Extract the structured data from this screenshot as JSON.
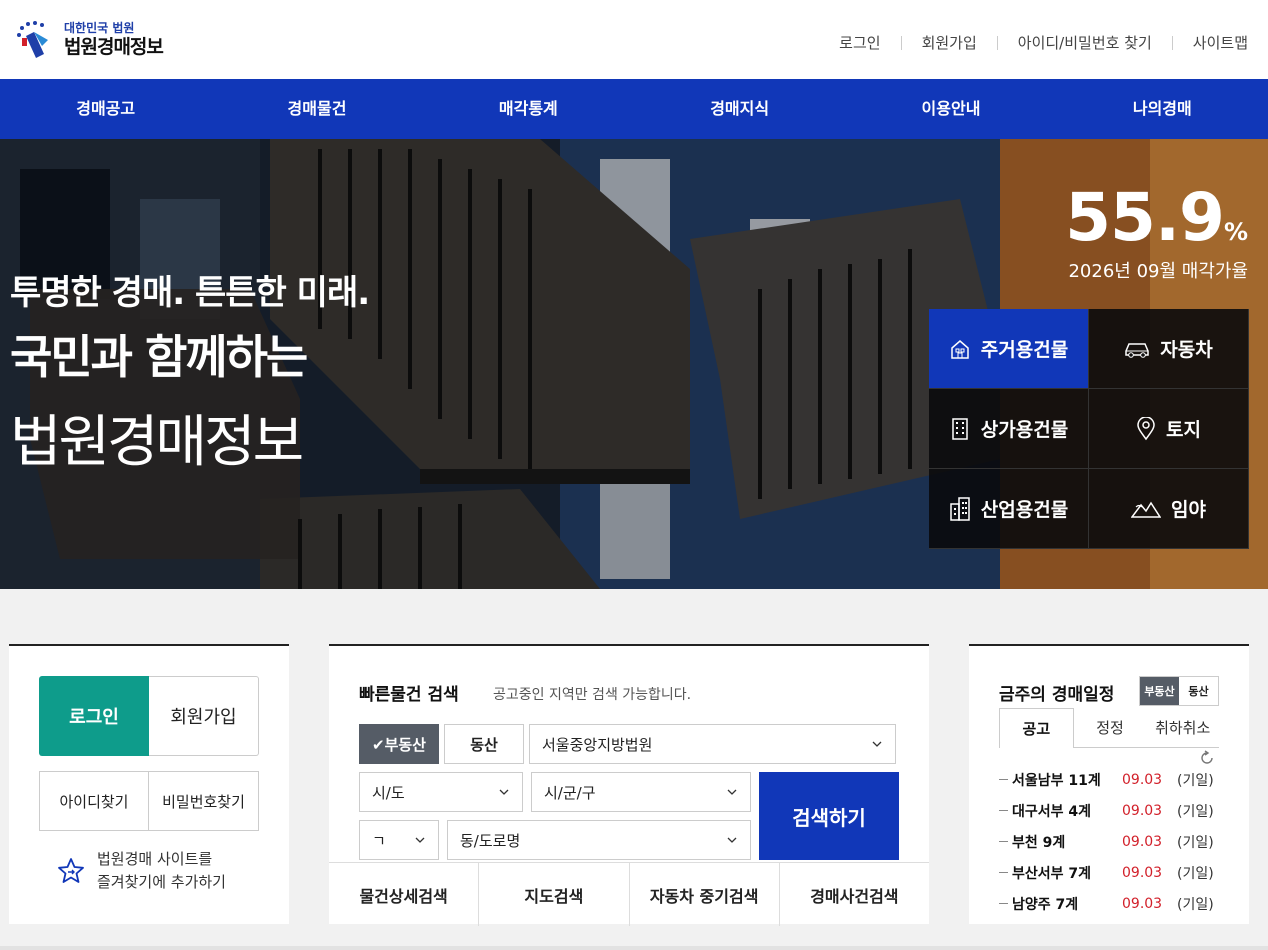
{
  "header": {
    "logo_small": "대한민국 법원",
    "logo_big": "법원경매정보",
    "util": [
      "로그인",
      "회원가입",
      "아이디/비밀번호 찾기",
      "사이트맵"
    ]
  },
  "nav": [
    "경매공고",
    "경매물건",
    "매각통계",
    "경매지식",
    "이용안내",
    "나의경매"
  ],
  "hero": {
    "line1": "투명한 경매. 튼튼한 미래.",
    "line2": "국민과 함께하는",
    "line3": "법원경매정보",
    "rate_value": "55.9",
    "rate_unit": "%",
    "rate_label": "2026년 09월 매각가율"
  },
  "categories": [
    {
      "label": "주거용건물",
      "icon": "house-icon",
      "active": true
    },
    {
      "label": "자동차",
      "icon": "car-icon",
      "active": false
    },
    {
      "label": "상가용건물",
      "icon": "building-icon",
      "active": false
    },
    {
      "label": "토지",
      "icon": "location-pin-icon",
      "active": false
    },
    {
      "label": "산업용건물",
      "icon": "factory-building-icon",
      "active": false
    },
    {
      "label": "임야",
      "icon": "mountain-icon",
      "active": false
    }
  ],
  "login_panel": {
    "login": "로그인",
    "join": "회원가입",
    "find_id": "아이디찾기",
    "find_pw": "비밀번호찾기",
    "fav_line1": "법원경매 사이트를",
    "fav_line2": "즐겨찾기에 추가하기"
  },
  "search_panel": {
    "title": "빠른물건 검색",
    "note": "공고중인 지역만 검색 가능합니다.",
    "seg_real": "✔부동산",
    "seg_movable": "동산",
    "court": "서울중앙지방법원",
    "sido": "시/도",
    "sigungu": "시/군/구",
    "initial": "ㄱ",
    "dong": "동/도로명",
    "search_btn": "검색하기",
    "tabs": [
      "물건상세검색",
      "지도검색",
      "자동차 중기검색",
      "경매사건검색"
    ]
  },
  "schedule_panel": {
    "title": "금주의 경매일정",
    "toggle": [
      "부동산",
      "동산"
    ],
    "tabs": [
      "공고",
      "정정",
      "취하취소"
    ],
    "rows": [
      {
        "court": "서울남부 11계",
        "date": "09.03",
        "status": "(기일)"
      },
      {
        "court": "대구서부 4계",
        "date": "09.03",
        "status": "(기일)"
      },
      {
        "court": "부천 9계",
        "date": "09.03",
        "status": "(기일)"
      },
      {
        "court": "부산서부 7계",
        "date": "09.03",
        "status": "(기일)"
      },
      {
        "court": "남양주 7계",
        "date": "09.03",
        "status": "(기일)"
      }
    ]
  },
  "colors": {
    "brand_blue": "#1137b8",
    "login_teal": "#0e9c8b",
    "date_red": "#d2202a",
    "toggle_gray": "#555c66"
  }
}
